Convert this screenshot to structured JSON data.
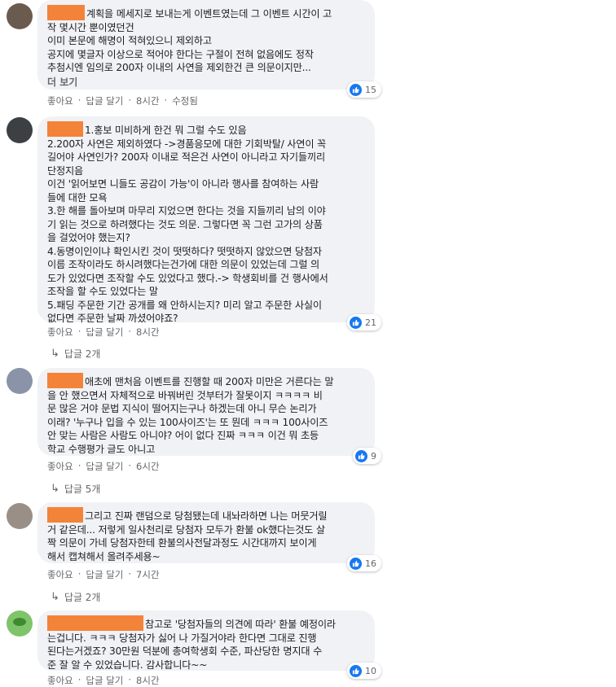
{
  "comments": [
    {
      "lines": [
        "계획을 메세지로 보내는게 이벤트였는데 그 이벤트 시간이 고",
        "작 몇시간 뿐이였던건",
        "이미 본문에 해명이 적혀있으니 제외하고",
        "공지에 몇글자 이상으로 적어야 한다는 구절이 전혀 없음에도 정작",
        "추첨시엔 임의로 200자 이내의 사연을 제외한건 큰 의문이지만..."
      ],
      "more": "더 보기",
      "like_count": "15",
      "actions": {
        "like": "좋아요",
        "reply": "답글 달기",
        "time": "8시간",
        "edited": "수정됨"
      }
    },
    {
      "lines": [
        "1.홍보 미비하게 한건 뭐 그럴 수도 있음",
        "2.200자 사연은 제외하였다 ->경품응모에 대한 기회박탈/ 사연이 꼭",
        "길어야 사연인가? 200자 이내로 적은건 사연이 아니라고 자기들끼리",
        "단정지음",
        "이건 '읽어보면 니들도 공감이 가능'이 아니라 행사를 참여하는 사람",
        "들에 대한 모욕",
        "3.한 해를 돌아보며 마무리 지었으면 한다는 것을 지들끼리 남의 이야",
        "기 읽는 것으로 하려했다는 것도 의문. 그렇다면 꼭 그런 고가의 상품",
        "을 걸었어야 했는지?",
        "4.동명이인이냐 확인시킨 것이 떳떳하다? 떳떳하지 않았으면 당첨자",
        "이름 조작이라도 하시려했다는건가에 대한 의문이 있었는데 그럴 의",
        "도가 있었다면 조작할 수도 있었다고 했다.-> 학생회비를 건 행사에서",
        "조작을 할 수도 있었다는 말",
        "5.패딩 주문한 기간 공개를 왜 안하시는지? 미리 알고 주문한 사실이",
        "없다면 주문한 날짜 까셨어야죠?"
      ],
      "like_count": "21",
      "actions": {
        "like": "좋아요",
        "reply": "답글 달기",
        "time": "8시간"
      },
      "replies": "답글 2개"
    },
    {
      "lines": [
        "애초에 맨처음 이벤트를 진행할 때 200자 미만은 거른다는 말",
        "을 안 했으면서 자체적으로 바꿔버린 것부터가 잘못이지 ㅋㅋㅋㅋ 비",
        "문 많은 거야 문법 지식이 떨어지는구나 하겠는데 아니 무슨 논리가",
        "이래? '누구나 입을 수 있는 100사이즈'는 또 뭔데 ㅋㅋㅋ 100사이즈",
        "안 맞는 사람은 사람도 아니야? 어이 없다 진짜 ㅋㅋㅋ 이건 뭐 초등",
        "학교 수행평가 글도 아니고"
      ],
      "like_count": "9",
      "actions": {
        "like": "좋아요",
        "reply": "답글 달기",
        "time": "6시간"
      },
      "replies": "답글 5개"
    },
    {
      "lines": [
        "그리고 진짜 랜덤으로 당첨됐는데 내놔라하면 나는 머뭇거릴",
        "거 같은데... 저렇게 일사천리로 당첨자 모두가 환불 ok했다는것도 살",
        "짝 의문이 가네 당첨자한테 환불의사전달과정도 시간대까지 보이게",
        "해서 캡쳐해서 올려주세용~"
      ],
      "like_count": "16",
      "actions": {
        "like": "좋아요",
        "reply": "답글 달기",
        "time": "7시간"
      },
      "replies": "답글 2개"
    },
    {
      "lines": [
        "참고로 '당첨자들의 의견에 따라' 환불 예정이라",
        "는겁니다. ㅋㅋㅋ 당첨자가 싫어 나 가질거야라 한다면 그대로 진행",
        "된다는거겠죠? 30만원 덕분에 총여학생회 수준, 파산당한 명지대 수",
        "준 잘 알 수 있었습니다. 감사합니다~~"
      ],
      "like_count": "10",
      "actions": {
        "like": "좋아요",
        "reply": "답글 달기",
        "time": "8시간"
      }
    }
  ],
  "colors": {
    "bubble": "#f0f2f5",
    "redact": "#f4833a",
    "like": "#1877f2",
    "meta": "#65676b"
  }
}
